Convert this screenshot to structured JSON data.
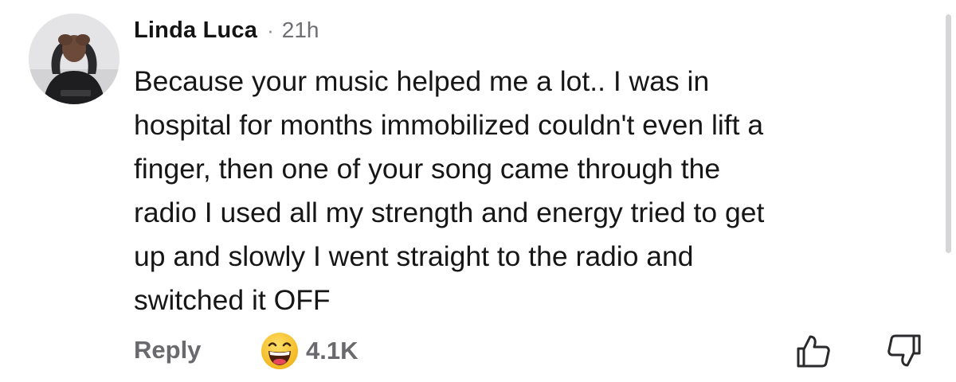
{
  "comment": {
    "author": "Linda Luca",
    "separator": "·",
    "time": "21h",
    "text_lines": [
      "Because your music helped me a lot.. I was in",
      "hospital for months immobilized couldn't even lift a",
      "finger, then one of your song came through the",
      "radio I used all my strength and energy tried to get",
      "up and slowly I went straight to the radio and",
      "switched it OFF"
    ]
  },
  "actions": {
    "reply_label": "Reply",
    "reaction_icon": "grinning-face-emoji-icon",
    "reaction_count": "4.1K",
    "like_icon": "thumbs-up-icon",
    "dislike_icon": "thumbs-down-icon"
  },
  "colors": {
    "text": "#161616",
    "muted": "#6a6a6e",
    "emoji_yellow": "#f6c23a"
  }
}
